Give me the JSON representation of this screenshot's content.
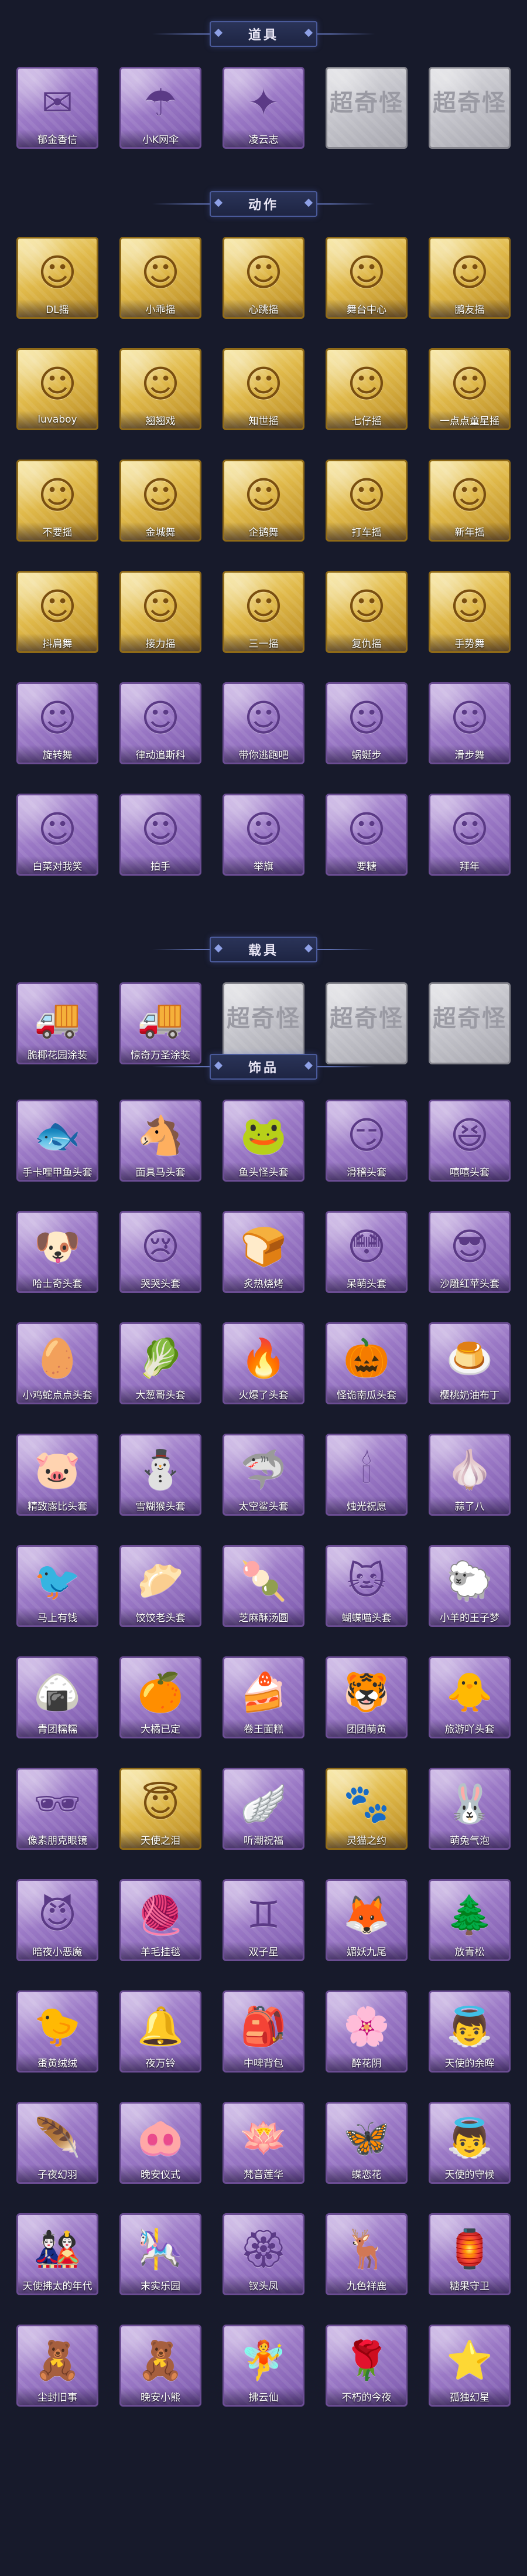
{
  "colors": {
    "background": "#171a2b",
    "card_purple": "#9b79c6",
    "card_gold": "#e0b94a",
    "card_grey": "#c1c1c8",
    "header_accent": "#4a5a9a"
  },
  "sections": [
    {
      "title": "道具",
      "items": [
        {
          "label": "郁金香信",
          "tier": "purple",
          "icon": "letter-icon",
          "glyph": "✉"
        },
        {
          "label": "小K网伞",
          "tier": "purple",
          "icon": "umbrella-icon",
          "glyph": "☂"
        },
        {
          "label": "凌云志",
          "tier": "purple",
          "icon": "fan-icon",
          "glyph": "✦"
        },
        {
          "label": "",
          "tier": "grey",
          "icon": "empty-slot-icon",
          "glyph": "超奇怪"
        },
        {
          "label": "",
          "tier": "grey",
          "icon": "empty-slot-icon",
          "glyph": "超奇怪"
        }
      ]
    },
    {
      "title": "动作",
      "items": [
        {
          "label": "DL摇",
          "tier": "gold",
          "icon": "dance-pose-icon",
          "glyph": "☺"
        },
        {
          "label": "小乖摇",
          "tier": "gold",
          "icon": "dance-pose-icon",
          "glyph": "☺"
        },
        {
          "label": "心跳摇",
          "tier": "gold",
          "icon": "dance-pose-icon",
          "glyph": "☺"
        },
        {
          "label": "舞台中心",
          "tier": "gold",
          "icon": "dance-pose-icon",
          "glyph": "☺"
        },
        {
          "label": "鹏友摇",
          "tier": "gold",
          "icon": "dance-pose-icon",
          "glyph": "☺"
        },
        {
          "label": "luvaboy",
          "tier": "gold",
          "icon": "dance-pose-icon",
          "glyph": "☺"
        },
        {
          "label": "翘翘戏",
          "tier": "gold",
          "icon": "dance-pose-icon",
          "glyph": "☺"
        },
        {
          "label": "知世摇",
          "tier": "gold",
          "icon": "dance-pose-icon",
          "glyph": "☺"
        },
        {
          "label": "七仔摇",
          "tier": "gold",
          "icon": "dance-pose-icon",
          "glyph": "☺"
        },
        {
          "label": "一点点童星摇",
          "tier": "gold",
          "icon": "dance-pose-icon",
          "glyph": "☺"
        },
        {
          "label": "不要摇",
          "tier": "gold",
          "icon": "dance-pose-icon",
          "glyph": "☺"
        },
        {
          "label": "金城舞",
          "tier": "gold",
          "icon": "dance-pose-icon",
          "glyph": "☺"
        },
        {
          "label": "企鹅舞",
          "tier": "gold",
          "icon": "dance-pose-icon",
          "glyph": "☺"
        },
        {
          "label": "打车摇",
          "tier": "gold",
          "icon": "dance-pose-icon",
          "glyph": "☺"
        },
        {
          "label": "新年摇",
          "tier": "gold",
          "icon": "dance-pose-icon",
          "glyph": "☺"
        },
        {
          "label": "抖肩舞",
          "tier": "gold",
          "icon": "dance-pose-icon",
          "glyph": "☺"
        },
        {
          "label": "接力摇",
          "tier": "gold",
          "icon": "dance-pose-icon",
          "glyph": "☺"
        },
        {
          "label": "三一摇",
          "tier": "gold",
          "icon": "dance-pose-icon",
          "glyph": "☺"
        },
        {
          "label": "复仇摇",
          "tier": "gold",
          "icon": "dance-pose-icon",
          "glyph": "☺"
        },
        {
          "label": "手势舞",
          "tier": "gold",
          "icon": "dance-pose-icon",
          "glyph": "☺"
        },
        {
          "label": "旋转舞",
          "tier": "purple",
          "icon": "dance-pose-icon",
          "glyph": "☺"
        },
        {
          "label": "律动追斯科",
          "tier": "purple",
          "icon": "dance-pose-icon",
          "glyph": "☺"
        },
        {
          "label": "带你逃跑吧",
          "tier": "purple",
          "icon": "dance-pose-icon",
          "glyph": "☺"
        },
        {
          "label": "蜗蜒步",
          "tier": "purple",
          "icon": "dance-pose-icon",
          "glyph": "☺"
        },
        {
          "label": "滑步舞",
          "tier": "purple",
          "icon": "dance-pose-icon",
          "glyph": "☺"
        },
        {
          "label": "白菜对我笑",
          "tier": "purple",
          "icon": "dance-pose-icon",
          "glyph": "☺"
        },
        {
          "label": "拍手",
          "tier": "purple",
          "icon": "dance-pose-icon",
          "glyph": "☺"
        },
        {
          "label": "举旗",
          "tier": "purple",
          "icon": "dance-pose-icon",
          "glyph": "☺"
        },
        {
          "label": "要糖",
          "tier": "purple",
          "icon": "dance-pose-icon",
          "glyph": "☺"
        },
        {
          "label": "拜年",
          "tier": "purple",
          "icon": "dance-pose-icon",
          "glyph": "☺"
        }
      ]
    },
    {
      "title": "载具",
      "items": [
        {
          "label": "脆椰花园涂装",
          "tier": "purple",
          "icon": "ice-cream-truck-icon",
          "glyph": "🚚"
        },
        {
          "label": "惊奇万圣涂装",
          "tier": "purple",
          "icon": "truck-icon",
          "glyph": "🚚"
        },
        {
          "label": "",
          "tier": "grey",
          "icon": "empty-slot-icon",
          "glyph": "超奇怪"
        },
        {
          "label": "",
          "tier": "grey",
          "icon": "empty-slot-icon",
          "glyph": "超奇怪"
        },
        {
          "label": "",
          "tier": "grey",
          "icon": "empty-slot-icon",
          "glyph": "超奇怪"
        }
      ]
    },
    {
      "title": "饰品",
      "items": [
        {
          "label": "手卡哩甲鱼头套",
          "tier": "purple",
          "icon": "fish-mask-icon",
          "glyph": "🐟"
        },
        {
          "label": "面具马头套",
          "tier": "purple",
          "icon": "horse-mask-icon",
          "glyph": "🐴"
        },
        {
          "label": "鱼头怪头套",
          "tier": "purple",
          "icon": "fish-head-icon",
          "glyph": "🐸"
        },
        {
          "label": "滑稽头套",
          "tier": "purple",
          "icon": "smiley-icon",
          "glyph": "😏"
        },
        {
          "label": "嘻嘻头套",
          "tier": "purple",
          "icon": "smiley-icon",
          "glyph": "😆"
        },
        {
          "label": "哈士奇头套",
          "tier": "purple",
          "icon": "dog-icon",
          "glyph": "🐶"
        },
        {
          "label": "哭哭头套",
          "tier": "purple",
          "icon": "crying-face-icon",
          "glyph": "😢"
        },
        {
          "label": "炙热烧烤",
          "tier": "purple",
          "icon": "toast-icon",
          "glyph": "🍞"
        },
        {
          "label": "呆萌头套",
          "tier": "purple",
          "icon": "smiley-icon",
          "glyph": "😳"
        },
        {
          "label": "沙雕红苹头套",
          "tier": "purple",
          "icon": "pikachu-icon",
          "glyph": "😎"
        },
        {
          "label": "小鸡蛇点点头套",
          "tier": "purple",
          "icon": "blob-icon",
          "glyph": "🥚"
        },
        {
          "label": "大葱哥头套",
          "tier": "purple",
          "icon": "cabbage-icon",
          "glyph": "🥬"
        },
        {
          "label": "火爆了头套",
          "tier": "purple",
          "icon": "fire-icon",
          "glyph": "🔥"
        },
        {
          "label": "怪诡南瓜头套",
          "tier": "purple",
          "icon": "pumpkin-icon",
          "glyph": "🎃"
        },
        {
          "label": "樱桃奶油布丁",
          "tier": "purple",
          "icon": "pudding-icon",
          "glyph": "🍮"
        },
        {
          "label": "精致露比头套",
          "tier": "purple",
          "icon": "pig-icon",
          "glyph": "🐷"
        },
        {
          "label": "雪糊猴头套",
          "tier": "purple",
          "icon": "snowman-icon",
          "glyph": "⛄"
        },
        {
          "label": "太空鲨头套",
          "tier": "purple",
          "icon": "shark-icon",
          "glyph": "🦈"
        },
        {
          "label": "烛光祝愿",
          "tier": "purple",
          "icon": "candle-icon",
          "glyph": "🕯"
        },
        {
          "label": "蒜了八",
          "tier": "purple",
          "icon": "garlic-icon",
          "glyph": "🧄"
        },
        {
          "label": "马上有钱",
          "tier": "purple",
          "icon": "bird-icon",
          "glyph": "🐦"
        },
        {
          "label": "饺饺老头套",
          "tier": "purple",
          "icon": "dumpling-icon",
          "glyph": "🥟"
        },
        {
          "label": "芝麻酥汤圆",
          "tier": "purple",
          "icon": "tangyuan-icon",
          "glyph": "🍡"
        },
        {
          "label": "蝴蝶喵头套",
          "tier": "purple",
          "icon": "cat-icon",
          "glyph": "🐱"
        },
        {
          "label": "小羊的王子梦",
          "tier": "purple",
          "icon": "sheep-icon",
          "glyph": "🐑"
        },
        {
          "label": "青团糯糯",
          "tier": "purple",
          "icon": "rice-ball-icon",
          "glyph": "🍙"
        },
        {
          "label": "大橘已定",
          "tier": "purple",
          "icon": "orange-icon",
          "glyph": "🍊"
        },
        {
          "label": "卷王面糕",
          "tier": "purple",
          "icon": "cake-roll-icon",
          "glyph": "🍰"
        },
        {
          "label": "团团萌黄",
          "tier": "purple",
          "icon": "cat-face-icon",
          "glyph": "🐯"
        },
        {
          "label": "旅游吖头套",
          "tier": "purple",
          "icon": "duck-icon",
          "glyph": "🐥"
        },
        {
          "label": "像素朋克眼镜",
          "tier": "purple",
          "icon": "pixel-glasses-icon",
          "glyph": "🕶"
        },
        {
          "label": "天使之泪",
          "tier": "gold",
          "icon": "halo-icon",
          "glyph": "😇"
        },
        {
          "label": "听潮祝福",
          "tier": "purple",
          "icon": "wings-icon",
          "glyph": "🪽"
        },
        {
          "label": "灵猫之约",
          "tier": "gold",
          "icon": "cat-ears-icon",
          "glyph": "🐾"
        },
        {
          "label": "萌兔气泡",
          "tier": "purple",
          "icon": "bunny-icon",
          "glyph": "🐰"
        },
        {
          "label": "暗夜小恶魔",
          "tier": "purple",
          "icon": "devil-icon",
          "glyph": "😈"
        },
        {
          "label": "羊毛挂毯",
          "tier": "purple",
          "icon": "tapestry-icon",
          "glyph": "🧶"
        },
        {
          "label": "双子星",
          "tier": "purple",
          "icon": "gemini-icon",
          "glyph": "♊"
        },
        {
          "label": "媚妖九尾",
          "tier": "purple",
          "icon": "fox-icon",
          "glyph": "🦊"
        },
        {
          "label": "放青松",
          "tier": "purple",
          "icon": "pine-tree-icon",
          "glyph": "🌲"
        },
        {
          "label": "蛋黄绒绒",
          "tier": "purple",
          "icon": "chick-icon",
          "glyph": "🐤"
        },
        {
          "label": "夜万铃",
          "tier": "purple",
          "icon": "wind-chime-icon",
          "glyph": "🔔"
        },
        {
          "label": "中啤背包",
          "tier": "purple",
          "icon": "backpack-icon",
          "glyph": "🎒"
        },
        {
          "label": "醉花阴",
          "tier": "purple",
          "icon": "flower-icon",
          "glyph": "🌸"
        },
        {
          "label": "天使的余晖",
          "tier": "purple",
          "icon": "angel-icon",
          "glyph": "👼"
        },
        {
          "label": "子夜幻羽",
          "tier": "purple",
          "icon": "feather-icon",
          "glyph": "🪶"
        },
        {
          "label": "晚安仪式",
          "tier": "purple",
          "icon": "pig-doll-icon",
          "glyph": "🐽"
        },
        {
          "label": "梵音莲华",
          "tier": "purple",
          "icon": "lotus-icon",
          "glyph": "🪷"
        },
        {
          "label": "蝶恋花",
          "tier": "purple",
          "icon": "butterfly-icon",
          "glyph": "🦋"
        },
        {
          "label": "天使的守候",
          "tier": "purple",
          "icon": "angel-doll-icon",
          "glyph": "👼"
        },
        {
          "label": "天使拂太的年代",
          "tier": "purple",
          "icon": "doll-icon",
          "glyph": "🎎"
        },
        {
          "label": "末实乐园",
          "tier": "purple",
          "icon": "carousel-icon",
          "glyph": "🎠"
        },
        {
          "label": "钗头凤",
          "tier": "purple",
          "icon": "hairpin-icon",
          "glyph": "🏵"
        },
        {
          "label": "九色祥鹿",
          "tier": "purple",
          "icon": "deer-icon",
          "glyph": "🦌"
        },
        {
          "label": "糖果守卫",
          "tier": "purple",
          "icon": "lantern-icon",
          "glyph": "🏮"
        },
        {
          "label": "尘封旧事",
          "tier": "purple",
          "icon": "boy-doll-icon",
          "glyph": "🧸"
        },
        {
          "label": "晚安小熊",
          "tier": "purple",
          "icon": "bear-doll-icon",
          "glyph": "🧸"
        },
        {
          "label": "拂云仙",
          "tier": "purple",
          "icon": "fairy-icon",
          "glyph": "🧚"
        },
        {
          "label": "不朽的今夜",
          "tier": "purple",
          "icon": "rose-icon",
          "glyph": "🌹"
        },
        {
          "label": "孤独幻星",
          "tier": "purple",
          "icon": "star-doll-icon",
          "glyph": "⭐"
        }
      ]
    }
  ]
}
